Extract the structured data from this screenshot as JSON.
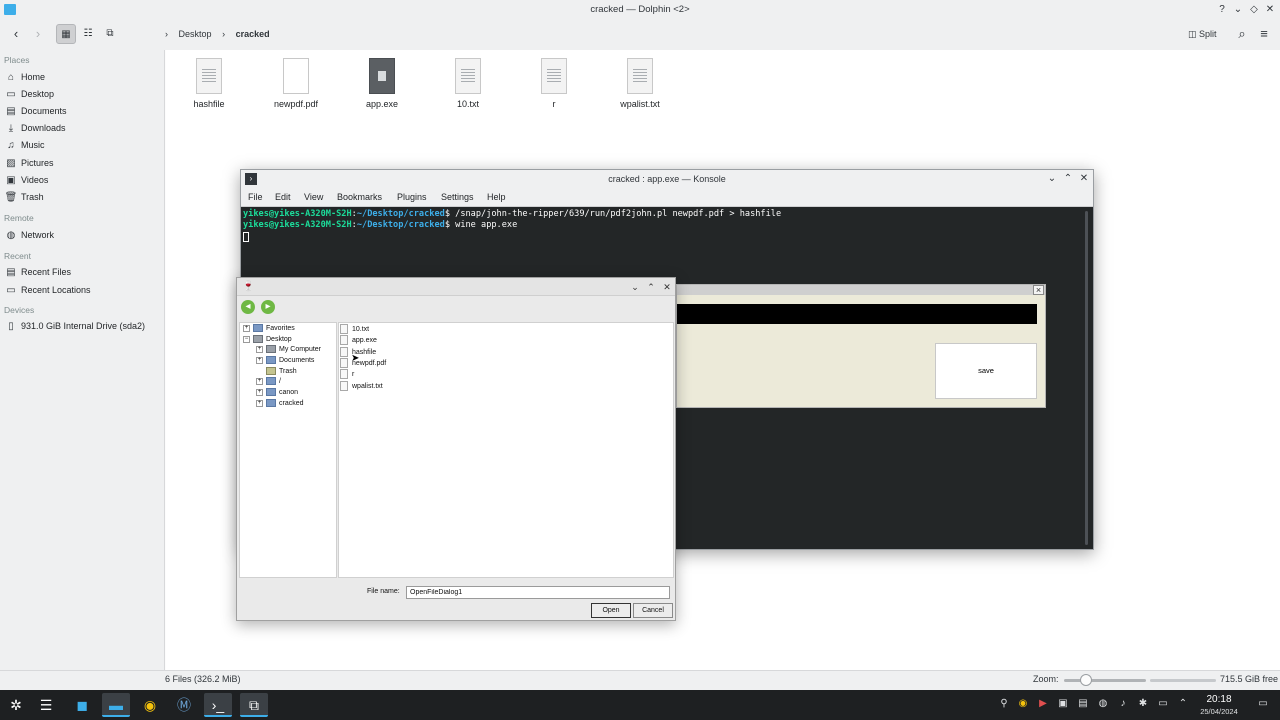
{
  "dolphin": {
    "title": "cracked — Dolphin <2>",
    "breadcrumb": [
      "Desktop",
      "cracked"
    ],
    "split_label": "Split",
    "sidebar": {
      "places_heading": "Places",
      "places": [
        {
          "label": "Home",
          "icon": "home-icon"
        },
        {
          "label": "Desktop",
          "icon": "desktop-icon"
        },
        {
          "label": "Documents",
          "icon": "documents-icon"
        },
        {
          "label": "Downloads",
          "icon": "downloads-icon"
        },
        {
          "label": "Music",
          "icon": "music-icon"
        },
        {
          "label": "Pictures",
          "icon": "pictures-icon"
        },
        {
          "label": "Videos",
          "icon": "videos-icon"
        },
        {
          "label": "Trash",
          "icon": "trash-icon"
        }
      ],
      "remote_heading": "Remote",
      "remote": [
        {
          "label": "Network",
          "icon": "network-icon"
        }
      ],
      "recent_heading": "Recent",
      "recent": [
        {
          "label": "Recent Files",
          "icon": "recent-files-icon"
        },
        {
          "label": "Recent Locations",
          "icon": "recent-locations-icon"
        }
      ],
      "devices_heading": "Devices",
      "devices": [
        {
          "label": "931.0 GiB Internal Drive (sda2)",
          "icon": "drive-icon"
        }
      ]
    },
    "files": [
      {
        "name": "hashfile",
        "kind": "text"
      },
      {
        "name": "newpdf.pdf",
        "kind": "pdf"
      },
      {
        "name": "app.exe",
        "kind": "exe"
      },
      {
        "name": "10.txt",
        "kind": "text"
      },
      {
        "name": "r",
        "kind": "text"
      },
      {
        "name": "wpalist.txt",
        "kind": "text"
      }
    ],
    "status": {
      "count": "6 Files (326.2 MiB)",
      "zoom_label": "Zoom:",
      "free_space": "715.5 GiB free"
    }
  },
  "konsole": {
    "title": "cracked : app.exe — Konsole",
    "menu": [
      "File",
      "Edit",
      "View",
      "Bookmarks",
      "Plugins",
      "Settings",
      "Help"
    ],
    "lines": [
      {
        "user": "yikes@yikes-A320M-S2H",
        "sep": ":",
        "path": "~/Desktop/cracked",
        "cmd": "$ /snap/john-the-ripper/639/run/pdf2john.pl newpdf.pdf > hashfile"
      },
      {
        "user": "yikes@yikes-A320M-S2H",
        "sep": ":",
        "path": "~/Desktop/cracked",
        "cmd": "$ wine app.exe"
      }
    ]
  },
  "app": {
    "close_glyph": "×",
    "save_label": "save"
  },
  "dialog": {
    "tree": [
      {
        "label": "Favorites",
        "expander": "+",
        "icon": "folder"
      },
      {
        "label": "Desktop",
        "expander": "−",
        "icon": "pc"
      },
      {
        "label": "My Computer",
        "expander": "+",
        "icon": "pc"
      },
      {
        "label": "Documents",
        "expander": "+",
        "icon": "folder"
      },
      {
        "label": "Trash",
        "expander": "",
        "icon": "trash"
      },
      {
        "label": "/",
        "expander": "+",
        "icon": "folder"
      },
      {
        "label": "canon",
        "expander": "+",
        "icon": "folder"
      },
      {
        "label": "cracked",
        "expander": "+",
        "icon": "folder"
      }
    ],
    "files": [
      "10.txt",
      "app.exe",
      "hashfile",
      "newpdf.pdf",
      "r",
      "wpalist.txt"
    ],
    "filename_label": "File name:",
    "filename_value": "OpenFileDialog1",
    "open_label": "Open",
    "cancel_label": "Cancel"
  },
  "taskbar": {
    "time": "20:18",
    "date": "25/04/2024"
  },
  "colors": {
    "prompt_user": "#1cdc9a",
    "prompt_path": "#3daee9",
    "terminal_bg": "#232627",
    "taskbar_bg": "#1e2022"
  }
}
